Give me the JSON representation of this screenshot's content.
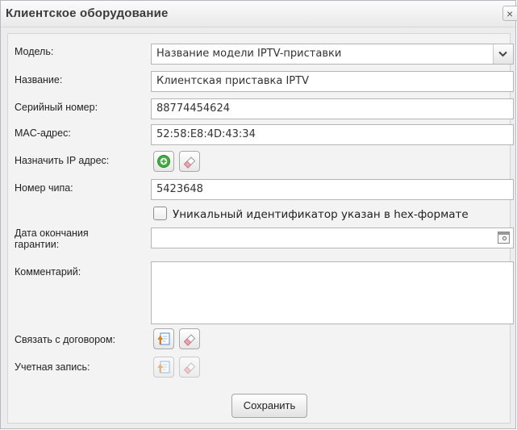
{
  "dialog": {
    "title": "Клиентское оборудование",
    "close_label": "×"
  },
  "form": {
    "model": {
      "label": "Модель:",
      "value": "Название модели IPTV-приставки"
    },
    "name": {
      "label": "Название:",
      "value": "Клиентская приставка IPTV"
    },
    "serial": {
      "label": "Серийный номер:",
      "value": "88774454624"
    },
    "mac": {
      "label": "MAC-адрес:",
      "value": "52:58:E8:4D:43:34"
    },
    "assign_ip": {
      "label": "Назначить IP адрес:"
    },
    "chip": {
      "label": "Номер чипа:",
      "value": "5423648"
    },
    "hex_checkbox": {
      "label": "Уникальный идентификатор указан в hex-формате",
      "checked": false
    },
    "warranty": {
      "label_line1": "Дата окончания",
      "label_line2": "гарантии:",
      "value": ""
    },
    "comment": {
      "label": "Комментарий:",
      "value": ""
    },
    "contract": {
      "label": "Связать с договором:"
    },
    "account": {
      "label": "Учетная запись:"
    },
    "save_label": "Сохранить"
  },
  "icons": {
    "add": "plus-circle-icon",
    "clear": "eraser-icon",
    "select": "document-select-icon",
    "calendar": "calendar-icon",
    "dropdown": "chevron-down-icon"
  },
  "colors": {
    "add_green": "#3fae3f",
    "eraser_pink": "#f2a3b3",
    "doc_orange": "#e8891c",
    "doc_blue": "#6c9fd6"
  }
}
